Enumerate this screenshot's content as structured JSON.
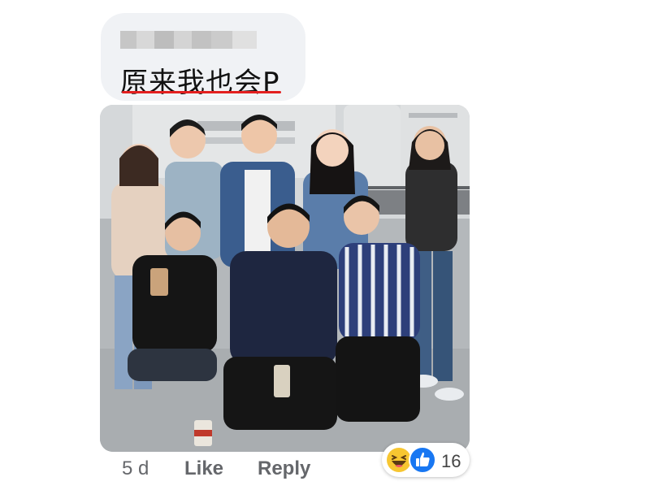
{
  "comment": {
    "author_name": "",
    "text": "原来我也会P",
    "underline_color": "#e32020"
  },
  "photo": {
    "icon": "group-photo-image"
  },
  "meta": {
    "time": "5 d",
    "like_label": "Like",
    "reply_label": "Reply"
  },
  "reactions": {
    "icons": [
      "haha-reaction-icon",
      "like-reaction-icon"
    ],
    "count": "16",
    "like_color": "#1877f2",
    "haha_color": "#f7c631"
  }
}
